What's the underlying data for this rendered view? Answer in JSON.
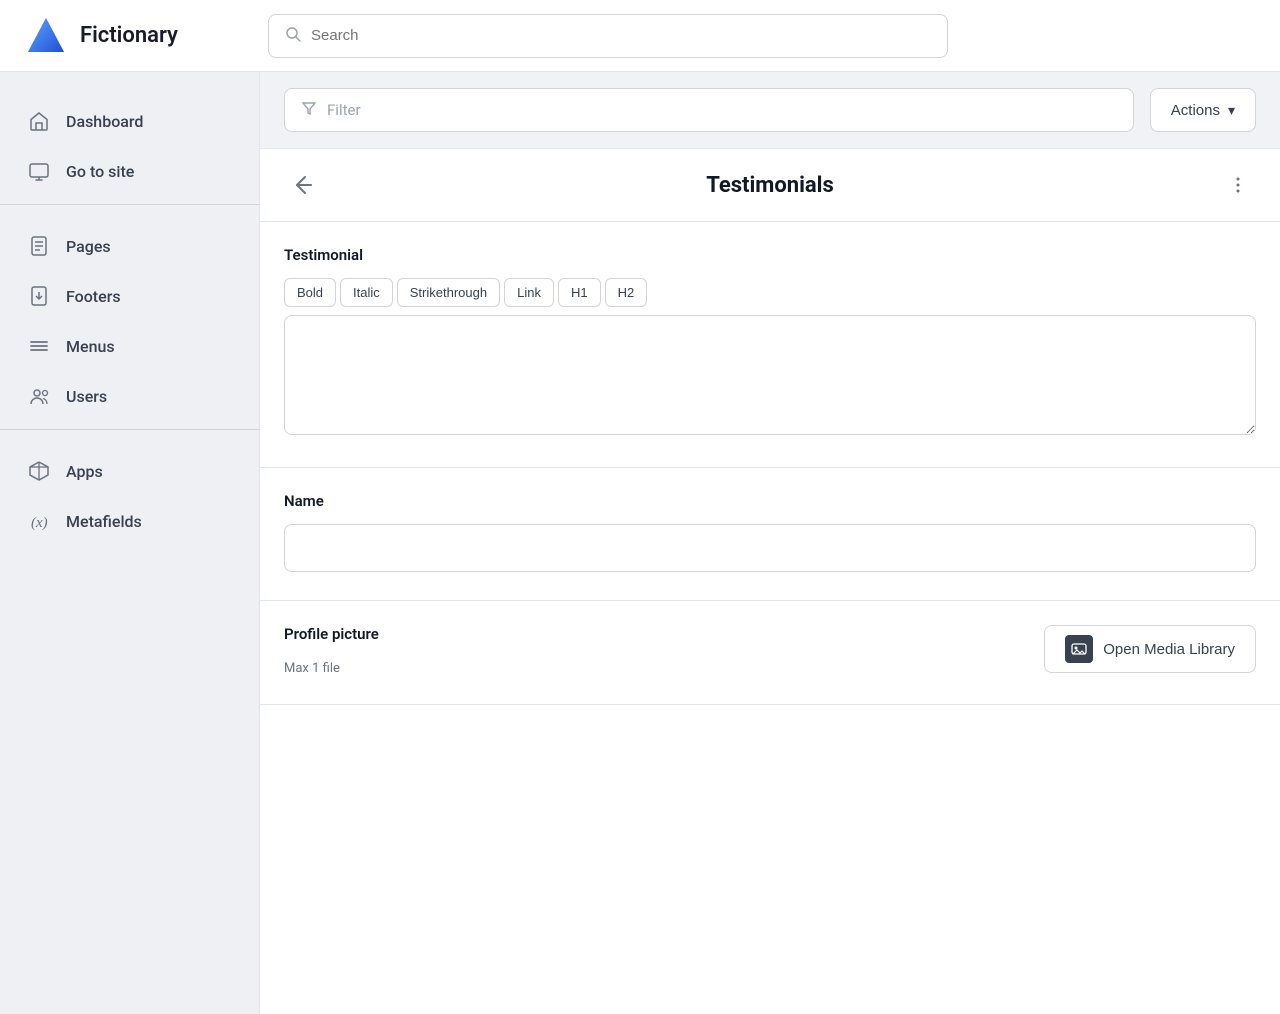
{
  "app": {
    "name": "Fictionary"
  },
  "header": {
    "search_placeholder": "Search"
  },
  "sidebar": {
    "top_items": [
      {
        "id": "dashboard",
        "label": "Dashboard",
        "icon": "home"
      },
      {
        "id": "go-to-site",
        "label": "Go to site",
        "icon": "monitor"
      }
    ],
    "middle_items": [
      {
        "id": "pages",
        "label": "Pages",
        "icon": "file"
      },
      {
        "id": "footers",
        "label": "Footers",
        "icon": "download-file"
      },
      {
        "id": "menus",
        "label": "Menus",
        "icon": "menu"
      },
      {
        "id": "users",
        "label": "Users",
        "icon": "users"
      }
    ],
    "bottom_items": [
      {
        "id": "apps",
        "label": "Apps",
        "icon": "cube"
      },
      {
        "id": "metafields",
        "label": "Metafields",
        "icon": "variable"
      }
    ]
  },
  "filter_bar": {
    "filter_placeholder": "Filter",
    "actions_label": "Actions",
    "chevron_icon": "▾"
  },
  "panel": {
    "back_label": "Back",
    "title": "Testimonials",
    "more_label": "More options"
  },
  "form": {
    "sections": [
      {
        "id": "testimonial",
        "label": "Testimonial",
        "type": "richtext",
        "toolbar": [
          "Bold",
          "Italic",
          "Strikethrough",
          "Link",
          "H1",
          "H2"
        ],
        "value": ""
      },
      {
        "id": "name",
        "label": "Name",
        "type": "text",
        "value": ""
      },
      {
        "id": "profile_picture",
        "label": "Profile picture",
        "sublabel": "Max 1 file",
        "type": "media",
        "button_label": "Open Media Library"
      }
    ]
  }
}
